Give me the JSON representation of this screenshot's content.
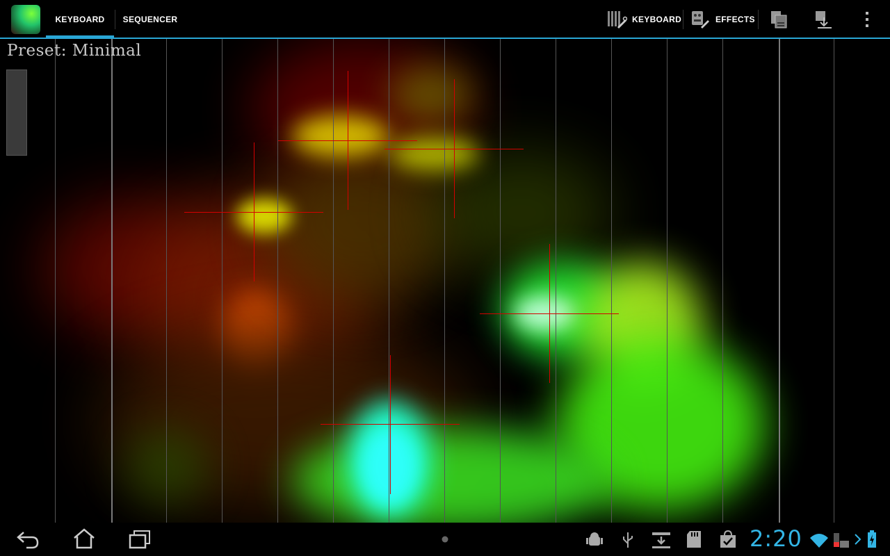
{
  "action_bar": {
    "tabs": [
      {
        "label": "KEYBOARD",
        "selected": true
      },
      {
        "label": "SEQUENCER",
        "selected": false
      }
    ],
    "actions": {
      "keyboard_label": "KEYBOARD",
      "effects_label": "EFFECTS"
    },
    "accent_color": "#2aa7d6"
  },
  "surface": {
    "preset_label": "Preset: Minimal"
  },
  "system_bar": {
    "clock": "2:20",
    "clock_color": "#33b5e5"
  }
}
